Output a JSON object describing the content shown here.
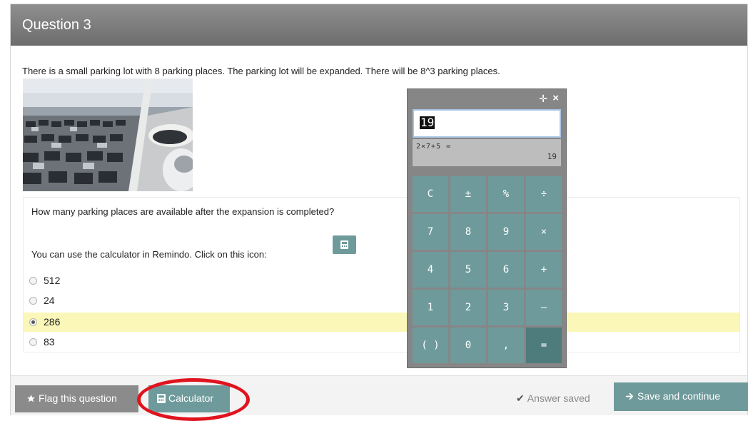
{
  "header": {
    "title": "Question 3"
  },
  "question": {
    "intro": "There is a small parking lot with 8 parking places. The parking lot will be expanded. There will be 8^3 parking places.",
    "prompt": "How many parking places are available after the expansion is completed?",
    "hint": "You can use the calculator in Remindo. Click on this icon:",
    "options": [
      {
        "label": "512",
        "selected": false
      },
      {
        "label": "24",
        "selected": false
      },
      {
        "label": "286",
        "selected": true
      },
      {
        "label": "83",
        "selected": false
      }
    ]
  },
  "calculator": {
    "display_value": "19",
    "history_expression": "2×7+5 =",
    "history_result": "19",
    "keys": [
      "C",
      "±",
      "%",
      "÷",
      "7",
      "8",
      "9",
      "×",
      "4",
      "5",
      "6",
      "+",
      "1",
      "2",
      "3",
      "–",
      "( )",
      "0",
      ",",
      "="
    ]
  },
  "footer": {
    "flag_label": "Flag this question",
    "calculator_label": "Calculator",
    "saved_label": "Answer saved",
    "save_label": "Save and continue"
  },
  "colors": {
    "accent": "#6f9a9b",
    "header": "#7a7a7a",
    "highlight": "#fbf7b8",
    "annotation": "#e0141e"
  },
  "icons": [
    "star-icon",
    "calculator-icon",
    "check-icon",
    "arrow-right-icon",
    "move-icon",
    "close-icon"
  ]
}
